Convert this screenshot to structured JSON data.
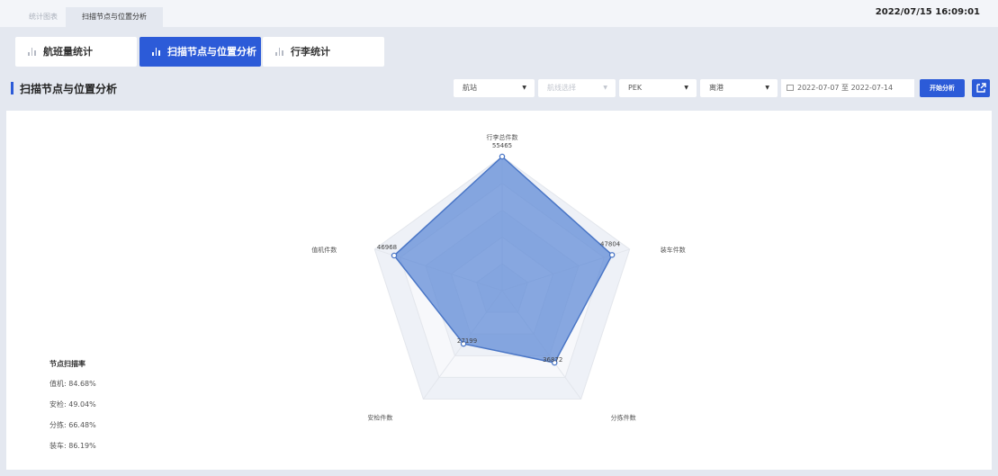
{
  "tabs": [
    {
      "label": "统计图表"
    },
    {
      "label": "扫描节点与位置分析"
    }
  ],
  "datetime": "2022/07/15 16:09:01",
  "cards": [
    {
      "label": "航班量统计"
    },
    {
      "label": "扫描节点与位置分析"
    },
    {
      "label": "行李统计"
    }
  ],
  "section_title": "扫描节点与位置分析",
  "filters": {
    "f1": "航站",
    "f2": "航线选择",
    "f3": "PEK",
    "f4": "离港",
    "date_from": "2022-07-07",
    "date_sep": "至",
    "date_to": "2022-07-14"
  },
  "analyze_label": "开始分析",
  "colors": {
    "accent": "#2c5bd8",
    "radar_fill": "#5b88d6",
    "radar_line": "#4a76c6"
  },
  "chart_data": {
    "type": "radar",
    "indicators": [
      "行李总件数",
      "装车件数",
      "分拣件数",
      "安检件数",
      "值机件数"
    ],
    "series": [
      {
        "values": [
          55465,
          47804,
          36872,
          27199,
          46968
        ]
      }
    ]
  },
  "node_rates": {
    "title": "节点扫描率",
    "items": [
      {
        "text": "值机: 84.68%"
      },
      {
        "text": "安检: 49.04%"
      },
      {
        "text": "分拣: 66.48%"
      },
      {
        "text": "装车: 86.19%"
      }
    ]
  }
}
